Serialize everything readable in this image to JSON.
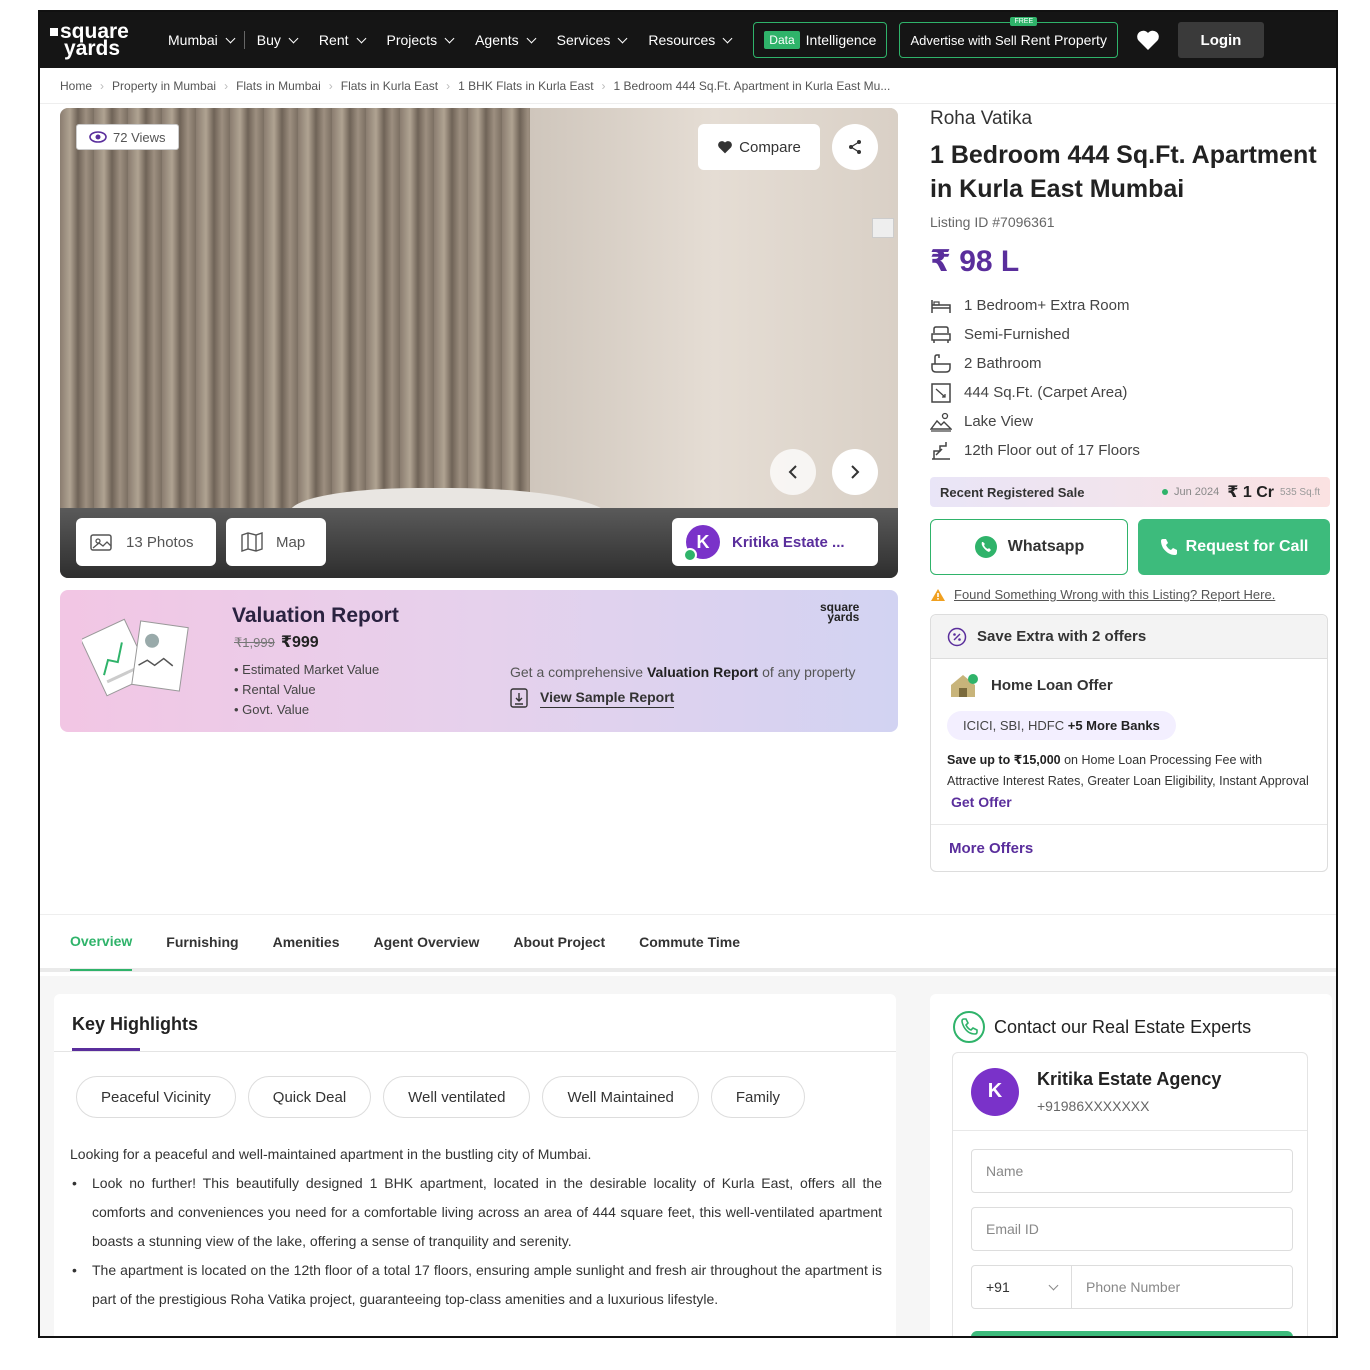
{
  "nav": {
    "logo_line1": "square",
    "logo_line2": "yards",
    "city": "Mumbai",
    "items": [
      "Buy",
      "Rent",
      "Projects",
      "Agents",
      "Services",
      "Resources"
    ],
    "data_tag": "Data",
    "intelligence": "Intelligence",
    "advertise": "Advertise with Sell",
    "free_tag": "FREE",
    "rent_property": "Rent Property",
    "login": "Login"
  },
  "breadcrumbs": [
    "Home",
    "Property in Mumbai",
    "Flats in Mumbai",
    "Flats in Kurla East",
    "1 BHK Flats in Kurla East",
    "1 Bedroom 444 Sq.Ft. Apartment in Kurla East Mu..."
  ],
  "gallery": {
    "views": "72 Views",
    "compare": "Compare",
    "photos": "13 Photos",
    "map": "Map",
    "agent_initial": "K",
    "agent_short": "Kritika Estate ..."
  },
  "valuation": {
    "title": "Valuation Report",
    "old_price": "₹1,999",
    "price": "₹999",
    "items": [
      "Estimated Market Value",
      "Rental Value",
      "Govt. Value"
    ],
    "brand_line1": "square",
    "brand_line2": "yards",
    "desc_pre": "Get a comprehensive",
    "desc_bold": "Valuation Report",
    "desc_post": "of any property",
    "sample": "View Sample Report"
  },
  "property": {
    "project": "Roha Vatika",
    "title": "1 Bedroom 444 Sq.Ft. Apartment in Kurla East Mumbai",
    "listing_id": "Listing ID #7096361",
    "price": "₹ 98 L",
    "features": [
      {
        "icon": "bed-icon",
        "text": "1 Bedroom+ Extra Room"
      },
      {
        "icon": "sofa-icon",
        "text": "Semi-Furnished"
      },
      {
        "icon": "bathtub-icon",
        "text": "2 Bathroom"
      },
      {
        "icon": "area-icon",
        "text": "444 Sq.Ft. (Carpet Area)"
      },
      {
        "icon": "view-icon",
        "text": "Lake View"
      },
      {
        "icon": "floor-icon",
        "text": "12th Floor out of 17 Floors"
      }
    ]
  },
  "recent_sale": {
    "label": "Recent Registered Sale",
    "date": "Jun 2024",
    "value": "₹ 1 Cr",
    "area": "535 Sq.ft"
  },
  "cta": {
    "whatsapp": "Whatsapp",
    "request_call": "Request for Call",
    "report": "Found Something Wrong with this Listing? Report Here."
  },
  "offers": {
    "header": "Save Extra with 2 offers",
    "home_loan_title": "Home Loan Offer",
    "banks": "ICICI, SBI, HDFC",
    "banks_more": "+5 More Banks",
    "save_bold": "Save up to ₹15,000",
    "save_text": "on Home Loan Processing Fee with Attractive Interest Rates, Greater Loan Eligibility, Instant Approval",
    "get_offer": "Get Offer",
    "more": "More Offers"
  },
  "tabs": [
    "Overview",
    "Furnishing",
    "Amenities",
    "Agent Overview",
    "About Project",
    "Commute Time"
  ],
  "highlights": {
    "title": "Key Highlights",
    "chips": [
      "Peaceful Vicinity",
      "Quick Deal",
      "Well ventilated",
      "Well Maintained",
      "Family"
    ],
    "intro": "Looking for a peaceful and well-maintained apartment in the bustling city of Mumbai.",
    "bullets": [
      "Look no further! This beautifully designed 1 BHK apartment, located in the desirable locality of Kurla East, offers all the comforts and conveniences you need for a comfortable living across an area of 444 square feet, this well-ventilated apartment boasts a stunning view of the lake, offering a sense of tranquility and serenity.",
      "The apartment is located on the 12th floor of a total 17 floors, ensuring ample sunlight and fresh air throughout the apartment is part of the prestigious Roha Vatika project, guaranteeing top-class amenities and a luxurious lifestyle."
    ]
  },
  "contact": {
    "title": "Contact our Real Estate Experts",
    "agent_initial": "K",
    "agent_name": "Kritika Estate Agency",
    "agent_phone": "+91986XXXXXXX",
    "name_placeholder": "Name",
    "email_placeholder": "Email ID",
    "country_code": "+91",
    "phone_placeholder": "Phone Number"
  },
  "colors": {
    "brand_purple": "#5a2e9c",
    "green": "#2fb36a",
    "nav_bg": "#151515"
  }
}
